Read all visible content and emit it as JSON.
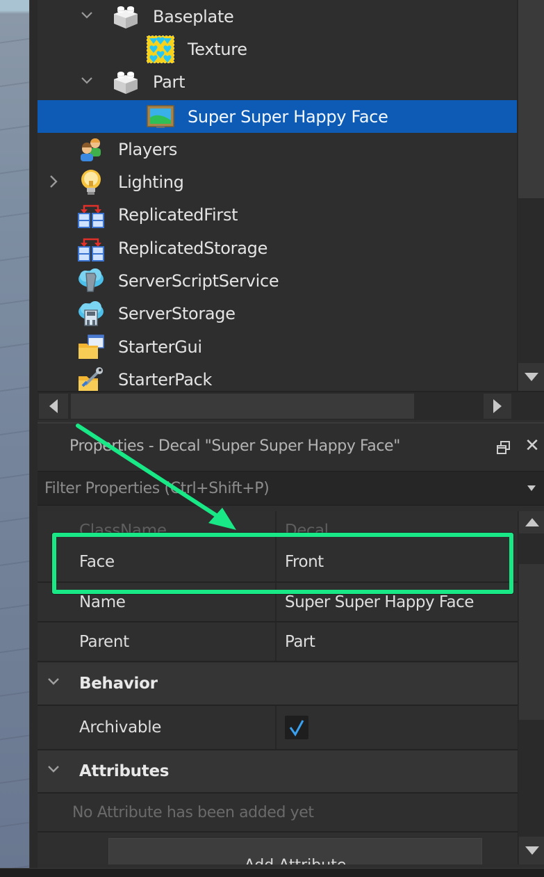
{
  "explorer": {
    "tree": [
      {
        "label": "Baseplate",
        "icon": "part-brick-icon",
        "expanded": true,
        "depth": 2
      },
      {
        "label": "Texture",
        "icon": "texture-icon",
        "depth": 3
      },
      {
        "label": "Part",
        "icon": "part-brick-icon",
        "expanded": true,
        "depth": 2
      },
      {
        "label": "Super Super Happy Face",
        "icon": "decal-icon",
        "depth": 3,
        "selected": true
      },
      {
        "label": "Players",
        "icon": "players-icon",
        "depth": 1
      },
      {
        "label": "Lighting",
        "icon": "lightbulb-icon",
        "expanded": false,
        "depth": 1
      },
      {
        "label": "ReplicatedFirst",
        "icon": "replicated-first-icon",
        "depth": 1
      },
      {
        "label": "ReplicatedStorage",
        "icon": "replicated-storage-icon",
        "depth": 1
      },
      {
        "label": "ServerScriptService",
        "icon": "server-script-service-icon",
        "depth": 1
      },
      {
        "label": "ServerStorage",
        "icon": "server-storage-icon",
        "depth": 1
      },
      {
        "label": "StarterGui",
        "icon": "starter-gui-icon",
        "depth": 1
      },
      {
        "label": "StarterPack",
        "icon": "starter-pack-icon",
        "depth": 1
      }
    ],
    "chevron_expanded": "⌄",
    "chevron_collapsed": "›"
  },
  "properties": {
    "title": "Properties - Decal \"Super Super Happy Face\"",
    "close_glyph": "✕",
    "filter_placeholder": "Filter Properties (Ctrl+Shift+P)",
    "rows": [
      {
        "name": "ClassName",
        "value": "Decal",
        "dim": true
      },
      {
        "name": "Face",
        "value": "Front",
        "highlighted": true
      },
      {
        "name": "Name",
        "value": "Super Super Happy Face"
      },
      {
        "name": "Parent",
        "value": "Part"
      }
    ],
    "sections": {
      "behavior": {
        "label": "Behavior",
        "rows": [
          {
            "name": "Archivable",
            "value": true
          }
        ]
      },
      "attributes": {
        "label": "Attributes",
        "empty_message": "No Attribute has been added yet",
        "add_button": "Add Attribute"
      }
    }
  },
  "annotation": {
    "color": "#19e887",
    "target": "Face"
  },
  "colors": {
    "selection": "#0e5bb5",
    "checkmark": "#3aa0f0"
  }
}
